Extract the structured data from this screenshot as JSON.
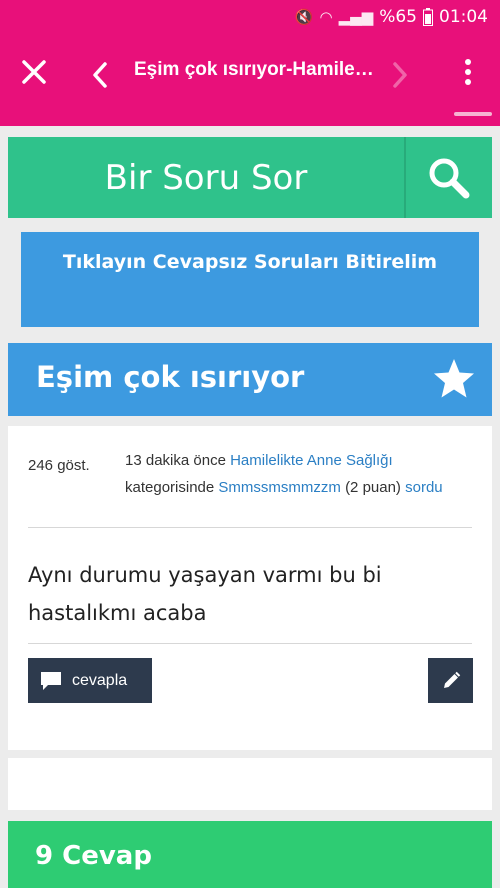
{
  "status": {
    "battery": "%65",
    "time": "01:04"
  },
  "appbar": {
    "title": "Eşim çok ısırıyor-Hamilel...",
    "back_icon": "chevron-left-icon",
    "forward_icon": "chevron-right-icon"
  },
  "ask": {
    "label": "Bir Soru Sor",
    "search_icon": "search-icon"
  },
  "banner": {
    "text": "Tıklayın Cevapsız Soruları Bitirelim"
  },
  "question": {
    "title": "Eşim çok ısırıyor",
    "views": "246 göst.",
    "time_ago": "13 dakika önce",
    "category": "Hamilelikte Anne Sağlığı",
    "category_suffix": "kategorisinde",
    "user": "Smmssmsmmzzm",
    "points": "(2 puan)",
    "verb": "sordu",
    "body": "Aynı durumu yaşayan varmı bu bi hastalıkmı acaba"
  },
  "actions": {
    "answer_label": "cevapla"
  },
  "answers": {
    "heading": "9 Cevap"
  },
  "colors": {
    "appbar": "#e8107a",
    "ask": "#2fc28b",
    "blue": "#3d9ae0",
    "answers": "#2ecc73",
    "button": "#2d3a4d",
    "link": "#2b7fc4"
  }
}
